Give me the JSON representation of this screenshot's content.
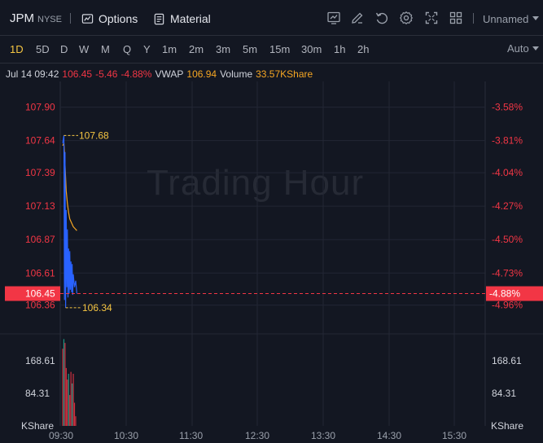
{
  "header": {
    "symbol": "JPM",
    "exchange": "NYSE",
    "options_label": "Options",
    "material_label": "Material",
    "layout_name": "Unnamed",
    "tools": [
      "line-chart-icon",
      "pencil-icon",
      "undo-icon",
      "gear-icon",
      "fullscreen-icon",
      "grid-layout-icon"
    ]
  },
  "periods": {
    "items": [
      "1D",
      "5D",
      "D",
      "W",
      "M",
      "Q",
      "Y",
      "1m",
      "2m",
      "3m",
      "5m",
      "15m",
      "30m",
      "1h",
      "2h"
    ],
    "active": "1D",
    "scale_mode": "Auto"
  },
  "info_line": {
    "datetime": "Jul 14 09:42",
    "price": "106.45",
    "change": "-5.46",
    "change_pct": "-4.88%",
    "vwap_label": "VWAP",
    "vwap_value": "106.94",
    "volume_label": "Volume",
    "volume_value": "33.57KShare"
  },
  "watermark": "Trading Hour",
  "colors": {
    "background": "#131722",
    "grid": "#232734",
    "down": "#f23645",
    "up": "#22ab94",
    "price_line": "#2962ff",
    "vwap_line": "#f5a623",
    "annotation": "#f5c542",
    "active_period": "#f5c542"
  },
  "chart_data": {
    "type": "line",
    "x_ticks": [
      "09:30",
      "10:30",
      "11:30",
      "12:30",
      "13:30",
      "14:30",
      "15:30"
    ],
    "x_range": [
      "09:30",
      "16:00"
    ],
    "y_left_ticks": [
      "107.90",
      "107.64",
      "107.39",
      "107.13",
      "106.87",
      "106.61",
      "106.36"
    ],
    "y_right_ticks": [
      "-3.58%",
      "-3.81%",
      "-4.04%",
      "-4.27%",
      "-4.50%",
      "-4.73%",
      "-4.96%"
    ],
    "y_range": [
      106.2,
      108.1
    ],
    "current_price": "106.45",
    "current_pct": "-4.88%",
    "high_label": "107.68",
    "low_label": "106.34",
    "price_series": [
      {
        "t": 0,
        "p": 107.62
      },
      {
        "t": 1,
        "p": 107.68
      },
      {
        "t": 1.5,
        "p": 106.4
      },
      {
        "t": 2,
        "p": 107.55
      },
      {
        "t": 2.5,
        "p": 106.34
      },
      {
        "t": 3,
        "p": 107.1
      },
      {
        "t": 3.5,
        "p": 106.5
      },
      {
        "t": 4,
        "p": 106.95
      },
      {
        "t": 4.5,
        "p": 106.42
      },
      {
        "t": 5,
        "p": 106.8
      },
      {
        "t": 5.5,
        "p": 106.45
      },
      {
        "t": 6,
        "p": 106.78
      },
      {
        "t": 6.5,
        "p": 106.48
      },
      {
        "t": 7,
        "p": 106.7
      },
      {
        "t": 7.5,
        "p": 106.46
      },
      {
        "t": 8,
        "p": 106.68
      },
      {
        "t": 8.5,
        "p": 106.44
      },
      {
        "t": 9,
        "p": 106.6
      },
      {
        "t": 10,
        "p": 106.5
      },
      {
        "t": 11,
        "p": 106.55
      },
      {
        "t": 12,
        "p": 106.45
      }
    ],
    "vwap_series": [
      {
        "t": 0,
        "p": 107.6
      },
      {
        "t": 1,
        "p": 107.62
      },
      {
        "t": 2,
        "p": 107.45
      },
      {
        "t": 3,
        "p": 107.25
      },
      {
        "t": 4,
        "p": 107.15
      },
      {
        "t": 5,
        "p": 107.08
      },
      {
        "t": 6,
        "p": 107.03
      },
      {
        "t": 7,
        "p": 107.01
      },
      {
        "t": 8,
        "p": 106.99
      },
      {
        "t": 9,
        "p": 106.97
      },
      {
        "t": 10,
        "p": 106.96
      },
      {
        "t": 11,
        "p": 106.95
      },
      {
        "t": 12,
        "p": 106.94
      }
    ],
    "volume_ticks_left": [
      "168.61",
      "84.31"
    ],
    "volume_ticks_right": [
      "168.61",
      "84.31"
    ],
    "volume_unit": "KShare",
    "volume_range": [
      0,
      230
    ],
    "volume_bars": [
      {
        "t": 0,
        "v": 200,
        "dir": "down"
      },
      {
        "t": 1,
        "v": 225,
        "dir": "up"
      },
      {
        "t": 2,
        "v": 215,
        "dir": "down"
      },
      {
        "t": 3,
        "v": 150,
        "dir": "down"
      },
      {
        "t": 4,
        "v": 120,
        "dir": "down"
      },
      {
        "t": 5,
        "v": 135,
        "dir": "up"
      },
      {
        "t": 6,
        "v": 80,
        "dir": "down"
      },
      {
        "t": 7,
        "v": 140,
        "dir": "down"
      },
      {
        "t": 8,
        "v": 110,
        "dir": "up"
      },
      {
        "t": 9,
        "v": 135,
        "dir": "down"
      },
      {
        "t": 10,
        "v": 60,
        "dir": "down"
      },
      {
        "t": 11,
        "v": 25,
        "dir": "down"
      }
    ]
  }
}
